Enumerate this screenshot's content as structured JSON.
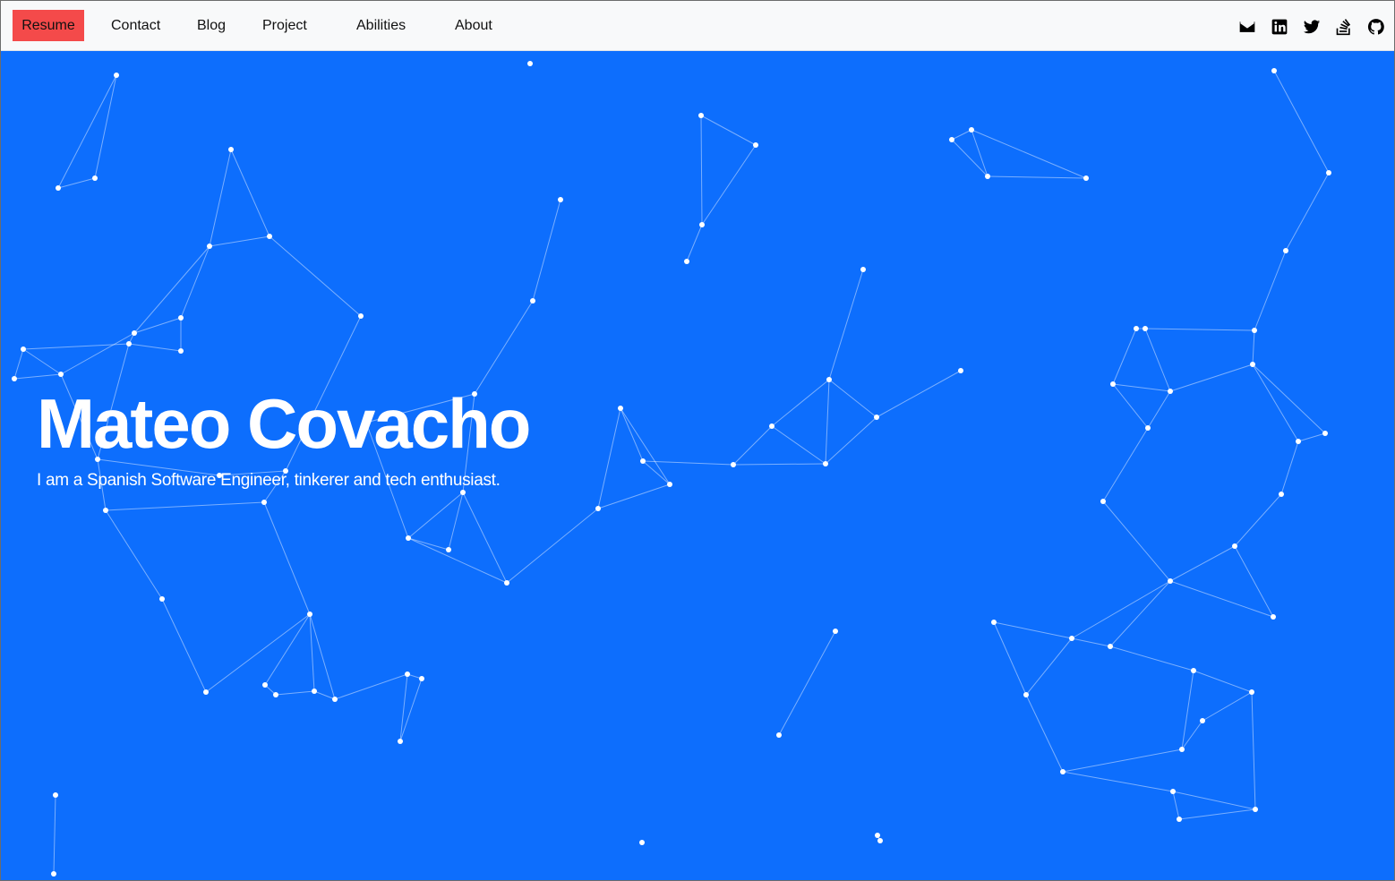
{
  "nav": {
    "resume_label": "Resume",
    "links": [
      {
        "label": "Contact"
      },
      {
        "label": "Blog"
      },
      {
        "label": "Project"
      },
      {
        "label": "Abilities"
      },
      {
        "label": "About"
      }
    ],
    "social_icons": [
      "mail-icon",
      "linkedin-icon",
      "twitter-icon",
      "stackoverflow-icon",
      "github-icon"
    ]
  },
  "hero": {
    "name": "Mateo Covacho",
    "tagline": "I am a Spanish Software Engineer, tinkerer and tech enthusiast."
  },
  "colors": {
    "accent": "#f44a4a",
    "background": "#0d6efd",
    "nav_bg": "#f8f9fa"
  }
}
